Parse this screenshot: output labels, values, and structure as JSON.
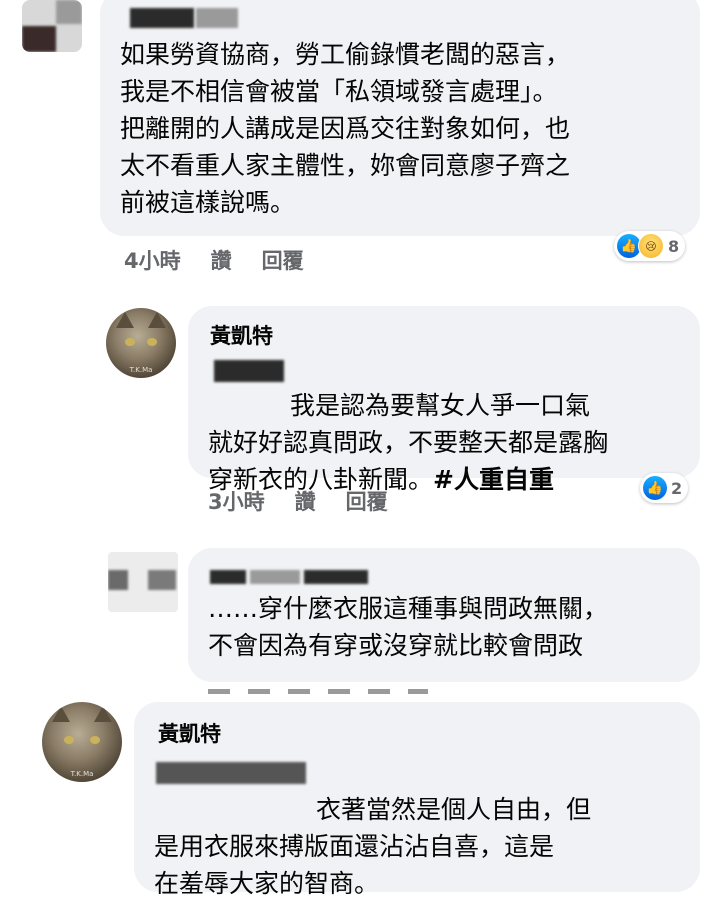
{
  "comments": [
    {
      "text": "如果勞資協商，勞工偷錄慣老闆的惡言，\n我是不相信會被當「私領域發言處理」。\n把離開的人講成是因爲交往對象如何，也\n太不看重人家主體性，妳會同意廖子齊之\n前被這樣說嗎。",
      "time": "4小時",
      "like": "讚",
      "reply": "回覆",
      "reaction_count": "8"
    },
    {
      "author": "黃凱特",
      "text_main": "我是認為要幫女人爭一口氣\n就好好認真問政，不要整天都是露胸\n穿新衣的八卦新聞。",
      "text_tag": "#人重自重",
      "time": "3小時",
      "like": "讚",
      "reply": "回覆",
      "reaction_count": "2"
    },
    {
      "text": "……穿什麼衣服這種事與問政無關，\n不會因為有穿或沒穿就比較會問政"
    },
    {
      "author": "黃凱特",
      "text_first": "衣著當然是個人自由，但",
      "text_rest": "是用衣服來搏版面還沾沾自喜，這是\n在羞辱大家的智商。"
    }
  ],
  "avatar_stamp": "T.K.Ma"
}
